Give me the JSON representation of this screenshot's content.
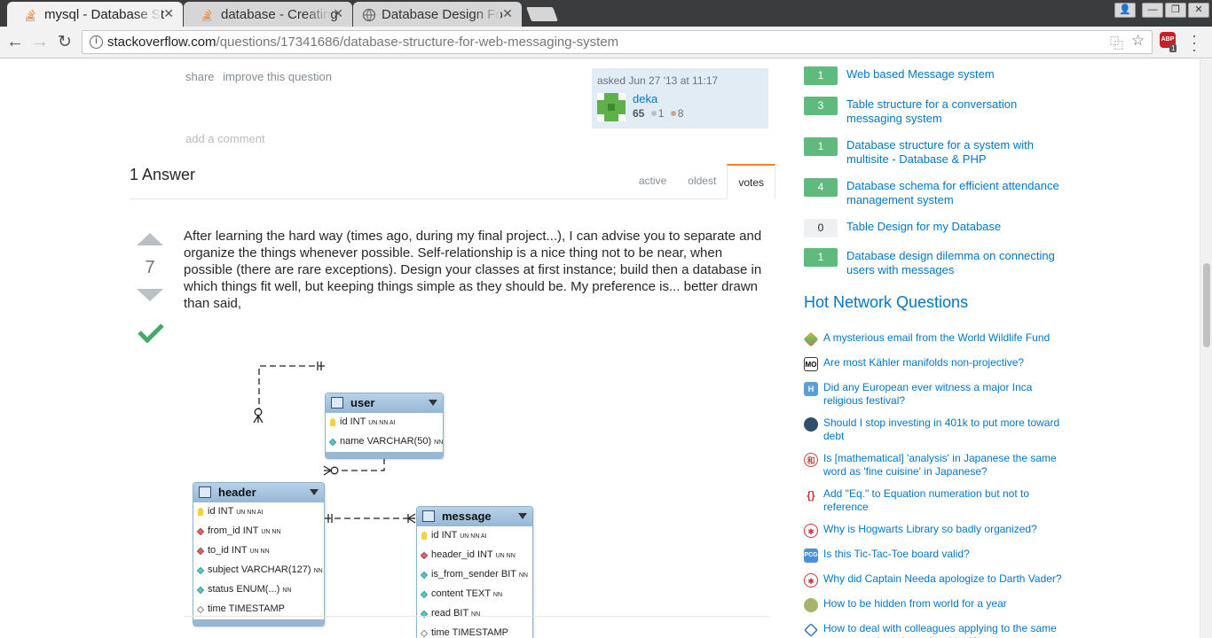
{
  "browser": {
    "tabs": [
      {
        "title": "mysql - Database St",
        "active": true
      },
      {
        "title": "database - Creating",
        "active": false
      },
      {
        "title": "Database Design Fo",
        "active": false
      }
    ],
    "url_host": "stackoverflow.com",
    "url_path": "/questions/17341686/database-structure-for-web-messaging-system",
    "abp_badge": "1"
  },
  "question": {
    "share_label": "share",
    "improve_label": "improve this question",
    "asked": "asked Jun 27 '13 at 11:17",
    "owner_name": "deka",
    "owner_rep": "65",
    "silver": "1",
    "bronze": "8",
    "add_comment": "add a comment"
  },
  "answers": {
    "heading": "1 Answer",
    "tabs": [
      "active",
      "oldest",
      "votes"
    ],
    "active_tab": "votes"
  },
  "answer": {
    "votes": "7",
    "text": "After learning the hard way (times ago, during my final project...), I can advise you to separate and organize the things whenever possible. Self-relationship is a nice thing not to be near, when possible (there are rare exceptions). Design your classes at first instance; build then a database in which things fit well, but keeping things simple as they should be. My preference is... better drawn than said,"
  },
  "diagram": {
    "user": {
      "name": "user",
      "rows": [
        {
          "t": "id INT ",
          "f": "UN NN AI",
          "icon": "key"
        },
        {
          "t": "name VARCHAR(50) ",
          "f": "NN",
          "icon": "teal"
        }
      ]
    },
    "header": {
      "name": "header",
      "rows": [
        {
          "t": "id INT ",
          "f": "UN NN AI",
          "icon": "key"
        },
        {
          "t": "from_id INT ",
          "f": "UN NN",
          "icon": "red"
        },
        {
          "t": "to_id INT ",
          "f": "UN NN",
          "icon": "red"
        },
        {
          "t": "subject VARCHAR(127) ",
          "f": "NN",
          "icon": "teal"
        },
        {
          "t": "status ENUM(...) ",
          "f": "NN",
          "icon": "teal"
        },
        {
          "t": "time TIMESTAMP",
          "f": "",
          "icon": "white"
        }
      ]
    },
    "message": {
      "name": "message",
      "rows": [
        {
          "t": "id INT ",
          "f": "UN NN AI",
          "icon": "key"
        },
        {
          "t": "header_id INT ",
          "f": "UN NN",
          "icon": "red"
        },
        {
          "t": "is_from_sender BIT ",
          "f": "NN",
          "icon": "teal"
        },
        {
          "t": "content TEXT ",
          "f": "NN",
          "icon": "teal"
        },
        {
          "t": "read BIT ",
          "f": "NN",
          "icon": "teal"
        },
        {
          "t": "time TIMESTAMP",
          "f": "",
          "icon": "white"
        }
      ]
    }
  },
  "related": [
    {
      "score": "1",
      "title": "Web based Message system"
    },
    {
      "score": "3",
      "title": "Table structure for a conversation messaging system"
    },
    {
      "score": "1",
      "title": "Database structure for a system with multisite - Database & PHP"
    },
    {
      "score": "4",
      "title": "Database schema for efficient attendance management system"
    },
    {
      "score": "0",
      "title": "Table Design for my Database"
    },
    {
      "score": "1",
      "title": "Database design dilemma on connecting users with messages"
    }
  ],
  "hot_network": {
    "title": "Hot Network Questions",
    "items": [
      {
        "icon": "diamond-icon",
        "title": "A mysterious email from the World Wildlife Fund"
      },
      {
        "icon": "mo-icon",
        "title": "Are most Kähler manifolds non-projective?"
      },
      {
        "icon": "history-icon",
        "title": "Did any European ever witness a major Inca religious festival?"
      },
      {
        "icon": "piggybank-icon",
        "title": "Should I stop investing in 401k to put more toward debt"
      },
      {
        "icon": "japanese-icon",
        "title": "Is [mathematical] 'analysis' in Japanese the same word as 'fine cuisine' in Japanese?"
      },
      {
        "icon": "tex-icon",
        "title": "Add \"Eq.\" to Equation numeration but not to reference"
      },
      {
        "icon": "scifi-icon",
        "title": "Why is Hogwarts Library so badly organized?"
      },
      {
        "icon": "puzzle-icon",
        "title": "Is this Tic-Tac-Toe board valid?"
      },
      {
        "icon": "scifi-icon",
        "title": "Why did Captain Needa apologize to Darth Vader?"
      },
      {
        "icon": "travel-icon",
        "title": "How to be hidden from world for a year"
      },
      {
        "icon": "workplace-icon",
        "title": "How to deal with colleagues applying to the same company where I was just hired?"
      }
    ]
  },
  "colors": {
    "accent": "#0077cc",
    "score_green": "#5eba7d",
    "vote_accept": "#48a868"
  }
}
